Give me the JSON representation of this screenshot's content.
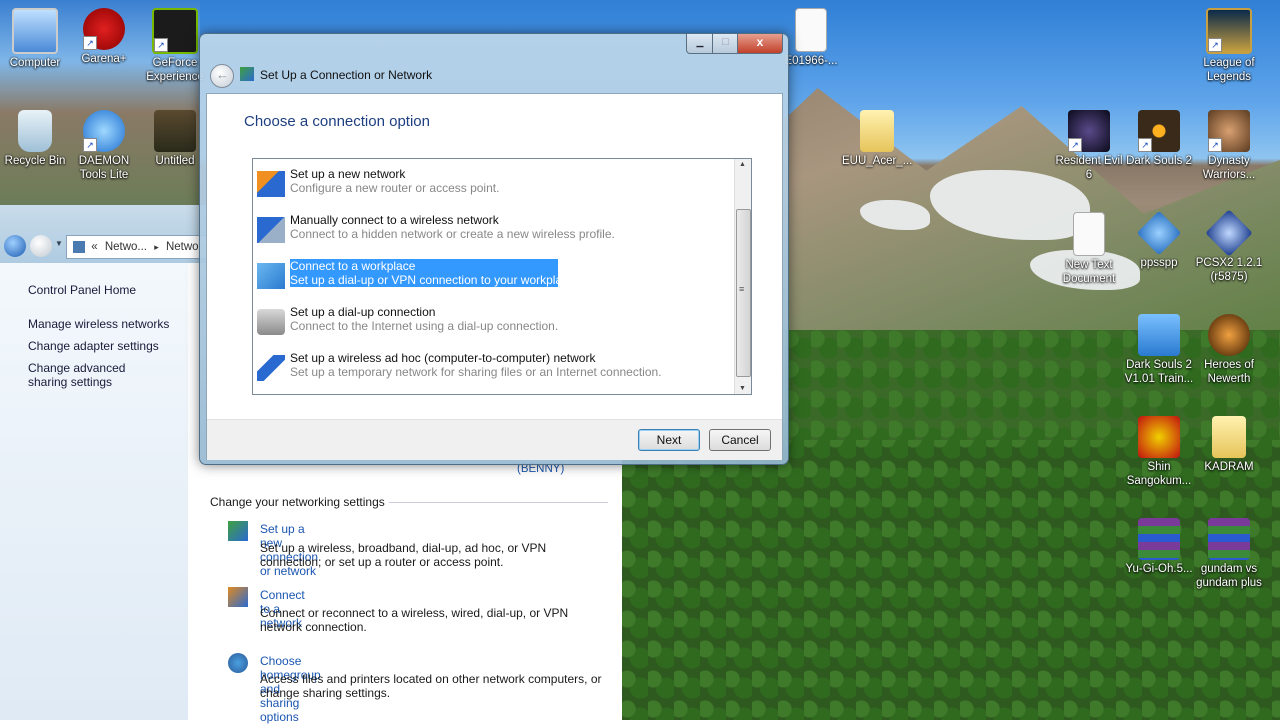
{
  "desktop": {
    "icons": [
      {
        "label": "Computer"
      },
      {
        "label": "Garena+"
      },
      {
        "label": "GeForce Experience"
      },
      {
        "label": "Recycle Bin"
      },
      {
        "label": "DAEMON Tools Lite"
      },
      {
        "label": "Untitled"
      },
      {
        "label": "E01966-..."
      },
      {
        "label": "EUU_Acer_..."
      },
      {
        "label": "League of Legends"
      },
      {
        "label": "Resident Evil 6"
      },
      {
        "label": "Dark Souls 2"
      },
      {
        "label": "Dynasty Warriors..."
      },
      {
        "label": "New Text Document"
      },
      {
        "label": "ppsspp"
      },
      {
        "label": "PCSX2 1.2.1 (r5875)"
      },
      {
        "label": "Dark Souls 2 V1.01 Train..."
      },
      {
        "label": "Heroes of Newerth"
      },
      {
        "label": "Shin Sangokum..."
      },
      {
        "label": "KADRAM"
      },
      {
        "label": "Yu-Gi-Oh.5..."
      },
      {
        "label": "gundam vs gundam plus"
      }
    ]
  },
  "control_panel": {
    "breadcrumb_prefix": "«",
    "breadcrumb_1": "Netwo...",
    "breadcrumb_sep": "▸",
    "breadcrumb_2": "Netwo",
    "sidebar": {
      "home": "Control Panel Home",
      "links": [
        "Manage wireless networks",
        "Change adapter settings",
        "Change advanced sharing settings"
      ]
    },
    "user_fragment": "(BENNY)",
    "section_title": "Change your networking settings",
    "tasks": [
      {
        "link": "Set up a new connection or network",
        "desc": "Set up a wireless, broadband, dial-up, ad hoc, or VPN connection; or set up a router or access point."
      },
      {
        "link": "Connect to a network",
        "desc": "Connect or reconnect to a wireless, wired, dial-up, or VPN network connection."
      },
      {
        "link": "Choose homegroup and sharing options",
        "desc": "Access files and printers located on other network computers, or change sharing settings."
      }
    ]
  },
  "dialog": {
    "title": "Set Up a Connection or Network",
    "heading": "Choose a connection option",
    "options": [
      {
        "title": "Set up a new network",
        "desc": "Configure a new router or access point.",
        "selected": false
      },
      {
        "title": "Manually connect to a wireless network",
        "desc": "Connect to a hidden network or create a new wireless profile.",
        "selected": false
      },
      {
        "title": "Connect to a workplace",
        "desc": "Set up a dial-up or VPN connection to your workplace.",
        "selected": true
      },
      {
        "title": "Set up a dial-up connection",
        "desc": "Connect to the Internet using a dial-up connection.",
        "selected": false
      },
      {
        "title": "Set up a wireless ad hoc (computer-to-computer) network",
        "desc": "Set up a temporary network for sharing files or an Internet connection.",
        "selected": false
      }
    ],
    "next_label": "Next",
    "cancel_label": "Cancel",
    "scroll_up": "▲",
    "scroll_down": "▼",
    "scroll_grip": "≡",
    "minimize_glyph": "▁",
    "maximize_glyph": "□",
    "close_glyph": "x"
  },
  "colors": {
    "selection": "#3399ff",
    "link": "#1a56b0",
    "heading": "#1e3f80"
  }
}
